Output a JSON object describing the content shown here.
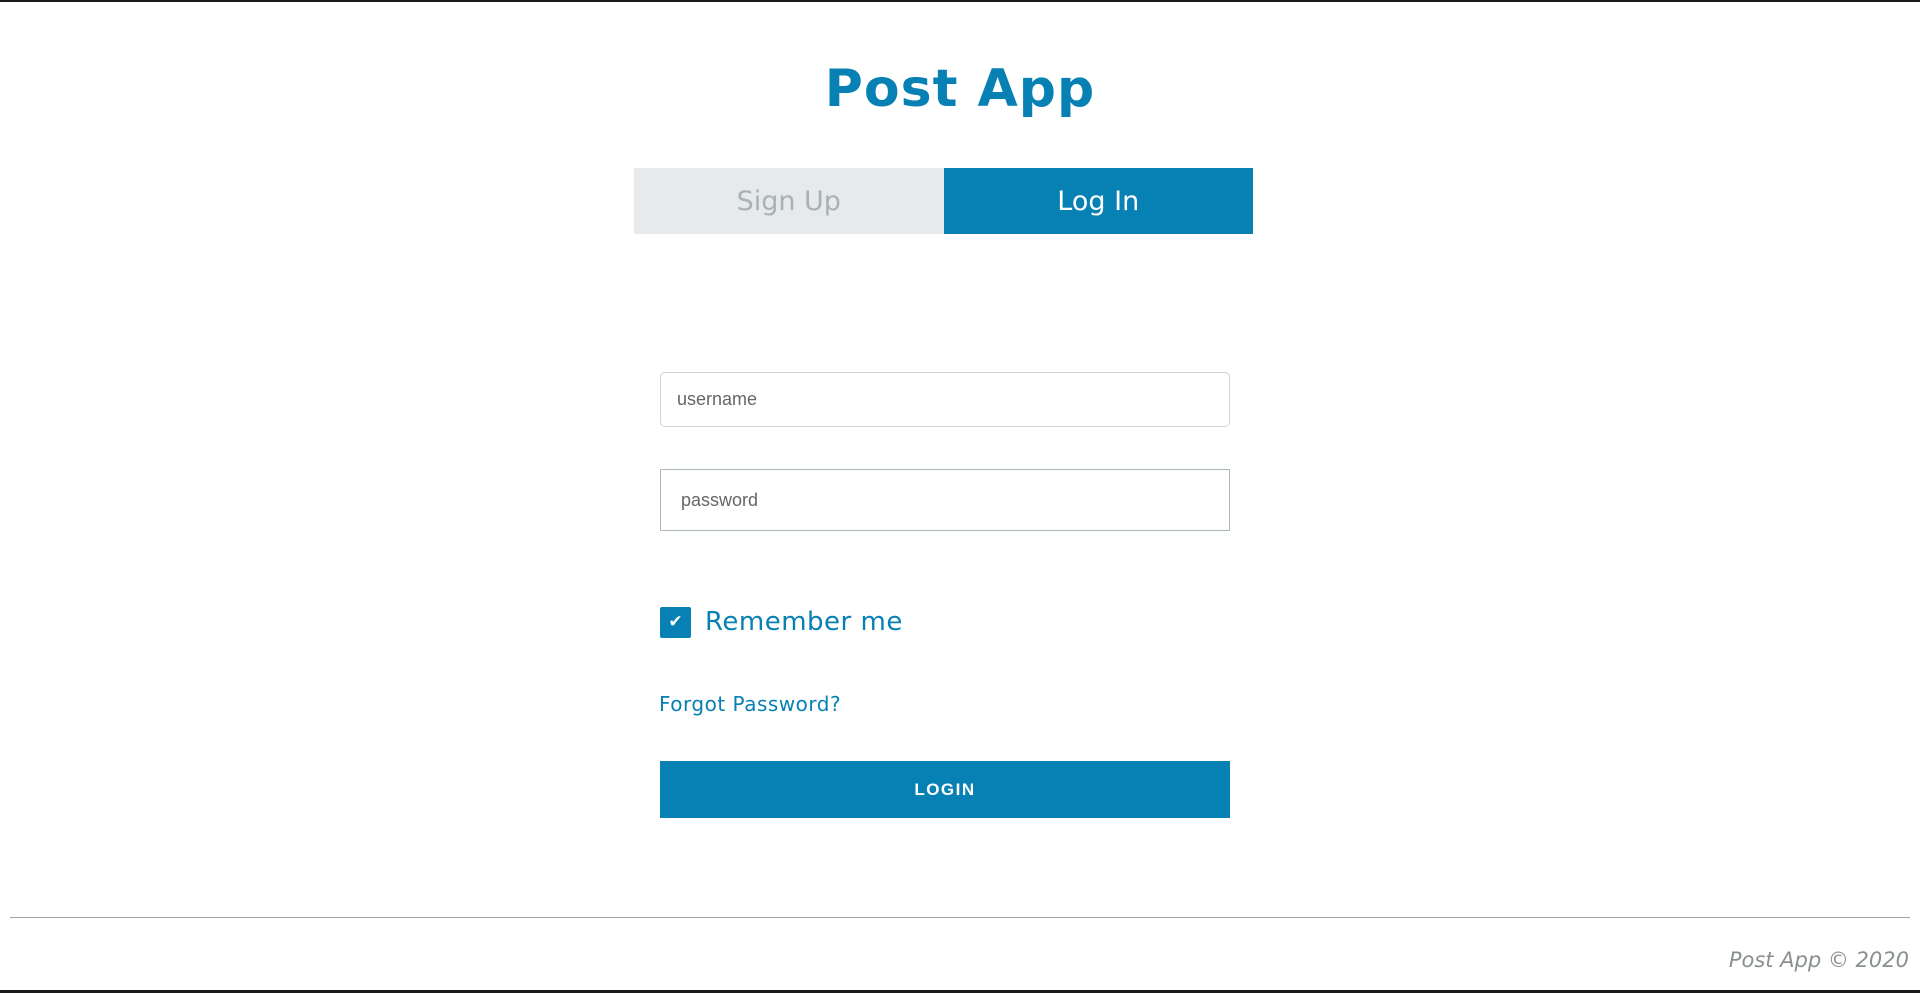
{
  "app": {
    "title": "Post App"
  },
  "tabs": [
    {
      "label": "Sign Up",
      "active": false
    },
    {
      "label": "Log In",
      "active": true
    }
  ],
  "form": {
    "username": {
      "placeholder": "username",
      "value": ""
    },
    "password": {
      "placeholder": "password",
      "value": ""
    },
    "remember_me": {
      "label": "Remember me",
      "checked": true,
      "check_glyph": "✔"
    },
    "forgot_password_label": "Forgot Password?",
    "submit_label": "LOGIN"
  },
  "footer": {
    "text": "Post App © 2020"
  },
  "colors": {
    "accent": "#0780b3",
    "tab_inactive_bg": "#e6eaea",
    "tab_inactive_text": "#a8b2b4",
    "footer_text": "#8a8f91"
  },
  "icons": {
    "checkbox": "checkmark-icon"
  }
}
